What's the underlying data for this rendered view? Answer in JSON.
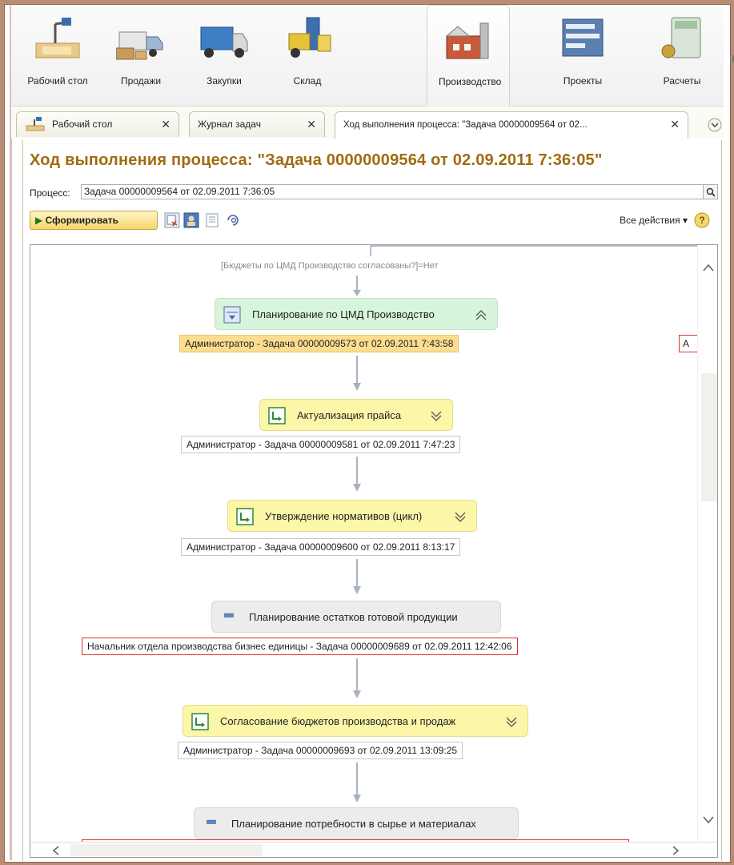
{
  "sections": [
    {
      "label": "Рабочий стол",
      "icon": "desk-lamp-icon"
    },
    {
      "label": "Продажи",
      "icon": "delivery-truck-icon"
    },
    {
      "label": "Закупки",
      "icon": "cargo-truck-icon"
    },
    {
      "label": "Склад",
      "icon": "forklift-icon"
    },
    {
      "label": "Производство",
      "icon": "factory-icon",
      "active": true
    },
    {
      "label": "Проекты",
      "icon": "gantt-chart-icon"
    },
    {
      "label": "Расчеты",
      "icon": "calculator-icon"
    }
  ],
  "tabs": [
    {
      "label": "Рабочий стол",
      "close": "✕"
    },
    {
      "label": "Журнал задач",
      "close": "✕"
    },
    {
      "label": "Ход выполнения процесса: \"Задача 00000009564 от 02...",
      "close": "✕",
      "active": true
    }
  ],
  "form": {
    "title": "Ход выполнения процесса: \"Задача 00000009564 от 02.09.2011 7:36:05\"",
    "process_label": "Процесс:",
    "process_value": "Задача 00000009564 от 02.09.2011 7:36:05",
    "generate_label": "Сформировать",
    "all_actions_label": "Все действия ▾",
    "help": "?"
  },
  "diagram": {
    "condition": "[Бюджеты по ЦМД Производство согласованы?]=Нет",
    "side_cut_label": "А",
    "steps": [
      {
        "name": "Планирование по ЦМД Производство",
        "style": "green",
        "task": "Администратор - Задача 00000009573 от 02.09.2011 7:43:58",
        "task_style": "orange",
        "chevron": "up"
      },
      {
        "name": "Актуализация прайса",
        "style": "yellow",
        "task": "Администратор - Задача 00000009581 от 02.09.2011 7:47:23",
        "task_style": "plain",
        "chevron": "down"
      },
      {
        "name": "Утверждение нормативов (цикл)",
        "style": "yellow",
        "task": "Администратор - Задача 00000009600 от 02.09.2011 8:13:17",
        "task_style": "plain",
        "chevron": "down"
      },
      {
        "name": "Планирование остатков готовой продукции",
        "style": "grey",
        "task": "Начальник отдела производства бизнес единицы - Задача 00000009689 от 02.09.2011 12:42:06",
        "task_style": "red",
        "chevron": "none"
      },
      {
        "name": "Согласование бюджетов производства и продаж",
        "style": "yellow",
        "task": "Администратор - Задача 00000009693 от 02.09.2011 13:09:25",
        "task_style": "plain",
        "chevron": "down"
      },
      {
        "name": "Планирование потребности в сырье и материалах",
        "style": "grey",
        "task": "",
        "task_style": "red",
        "chevron": "none"
      }
    ]
  },
  "colors": {
    "title": "#a06b10",
    "green_node": "#d7f4dc",
    "yellow_node": "#fcf6a9",
    "grey_node": "#ececec",
    "orange_task": "#fcdd90",
    "red_border": "#d9312c"
  }
}
